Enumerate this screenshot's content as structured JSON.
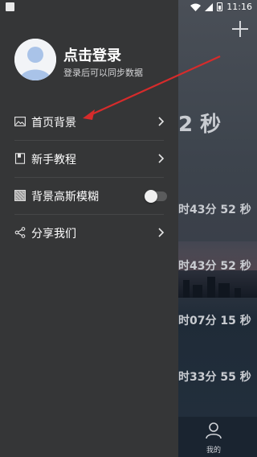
{
  "status_bar": {
    "time": "11:16"
  },
  "drawer": {
    "user": {
      "title": "点击登录",
      "subtitle": "登录后可以同步数据"
    },
    "menu": [
      {
        "label": "首页背景",
        "icon": "image-icon"
      },
      {
        "label": "新手教程",
        "icon": "book-icon"
      },
      {
        "label": "背景高斯模糊",
        "icon": "blur-icon",
        "toggle_on": false
      },
      {
        "label": "分享我们",
        "icon": "share-icon"
      }
    ]
  },
  "background_app": {
    "countdowns": [
      "2 秒",
      "时43分 52 秒",
      "时43分 52 秒",
      "时07分 15 秒",
      "时33分 55 秒"
    ],
    "tab_mine": "我的"
  },
  "colors": {
    "drawer_bg": "#353637",
    "annotation_arrow": "#d62b2b"
  }
}
